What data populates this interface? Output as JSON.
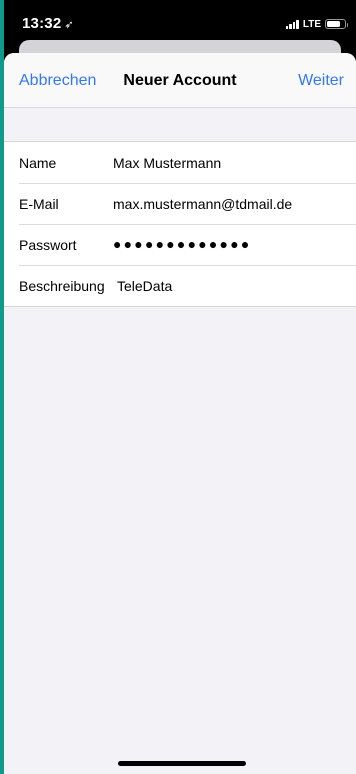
{
  "status_bar": {
    "time": "13:32",
    "location_glyph": "➶",
    "network": "LTE",
    "signal_bars": 4,
    "battery_level": 0.75
  },
  "nav": {
    "cancel_label": "Abbrechen",
    "title": "Neuer Account",
    "next_label": "Weiter"
  },
  "form": {
    "name": {
      "label": "Name",
      "value": "Max Mustermann"
    },
    "email": {
      "label": "E-Mail",
      "value": "max.mustermann@tdmail.de"
    },
    "password": {
      "label": "Passwort",
      "value": "●●●●●●●●●●●●●"
    },
    "description": {
      "label": "Beschreibung",
      "value": "TeleData"
    }
  },
  "colors": {
    "accent": "#3478f6",
    "background": "#f2f2f7"
  }
}
